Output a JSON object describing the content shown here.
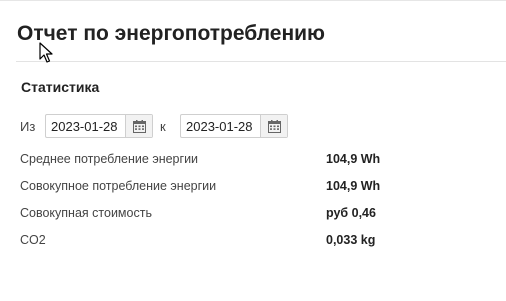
{
  "header": {
    "title": "Отчет по энергопотреблению"
  },
  "statistics": {
    "title": "Статистика",
    "date_range": {
      "from_label": "Из",
      "from_value": "2023-01-28",
      "to_label": "к",
      "to_value": "2023-01-28",
      "calendar_icon": "calendar-icon"
    },
    "rows": [
      {
        "label": "Среднее потребление энергии",
        "value": "104,9 Wh"
      },
      {
        "label": "Совокупное потребление энергии",
        "value": "104,9 Wh"
      },
      {
        "label": "Совокупная стоимость",
        "value": "руб 0,46"
      },
      {
        "label": "CO2",
        "value": "0,033 kg"
      }
    ]
  },
  "colors": {
    "text": "#222222",
    "muted_text": "#444444",
    "border": "#cfcfcf",
    "button_bg": "#f2f2f2"
  }
}
